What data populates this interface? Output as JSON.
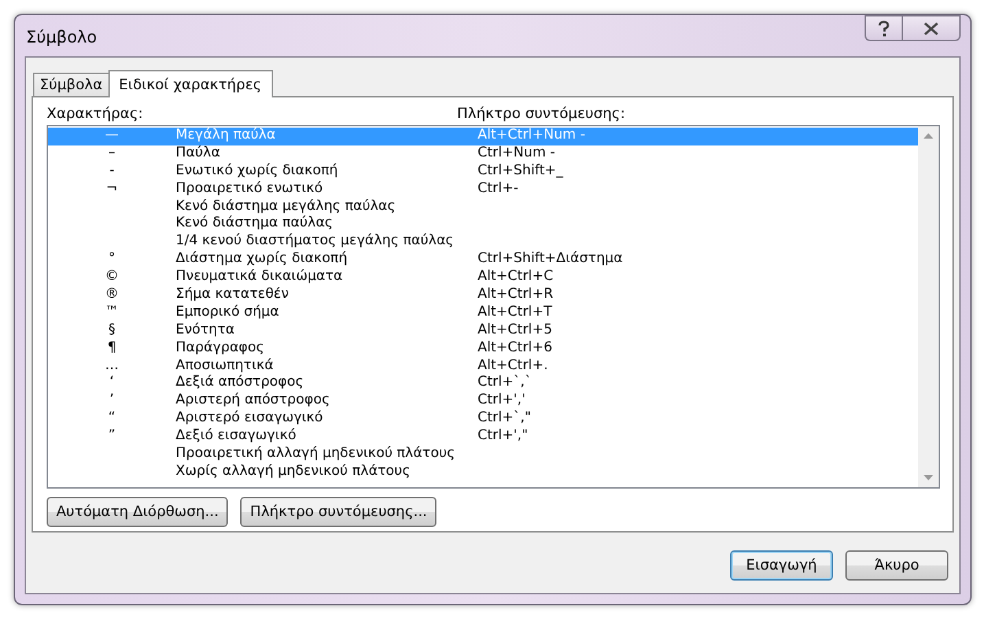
{
  "window": {
    "title": "Σύμβολο"
  },
  "tabs": [
    {
      "label": "Σύμβολα",
      "selected": false
    },
    {
      "label": "Ειδικοί χαρακτήρες",
      "selected": true
    }
  ],
  "list": {
    "columns": [
      "Χαρακτήρας:",
      "Πλήκτρο συντόμευσης:"
    ],
    "rows": [
      {
        "char": "—",
        "name": "Μεγάλη παύλα",
        "shortcut": "Alt+Ctrl+Num -",
        "selected": true
      },
      {
        "char": "–",
        "name": "Παύλα",
        "shortcut": "Ctrl+Num -",
        "selected": false
      },
      {
        "char": "-",
        "name": "Ενωτικό χωρίς διακοπή",
        "shortcut": "Ctrl+Shift+_",
        "selected": false
      },
      {
        "char": "¬",
        "name": "Προαιρετικό ενωτικό",
        "shortcut": "Ctrl+-",
        "selected": false
      },
      {
        "name": "Κενό διάστημα μεγάλης παύλας",
        "selected": false
      },
      {
        "name": "Κενό διάστημα παύλας",
        "selected": false
      },
      {
        "name": "1/4 κενού διαστήματος μεγάλης παύλας",
        "selected": false
      },
      {
        "char": "°",
        "name": "Διάστημα χωρίς διακοπή",
        "shortcut": "Ctrl+Shift+Διάστημα",
        "selected": false
      },
      {
        "char": "©",
        "name": "Πνευματικά δικαιώματα",
        "shortcut": "Alt+Ctrl+C",
        "selected": false
      },
      {
        "char": "®",
        "name": "Σήμα κατατεθέν",
        "shortcut": "Alt+Ctrl+R",
        "selected": false
      },
      {
        "char": "™",
        "name": "Εμπορικό σήμα",
        "shortcut": "Alt+Ctrl+T",
        "selected": false
      },
      {
        "char": "§",
        "name": "Ενότητα",
        "shortcut": "Alt+Ctrl+5",
        "selected": false
      },
      {
        "char": "¶",
        "name": "Παράγραφος",
        "shortcut": "Alt+Ctrl+6",
        "selected": false
      },
      {
        "char": "…",
        "name": "Αποσιωπητικά",
        "shortcut": "Alt+Ctrl+.",
        "selected": false
      },
      {
        "char": "‘",
        "name": "Δεξιά απόστροφος",
        "shortcut": "Ctrl+`,`",
        "selected": false
      },
      {
        "char": "’",
        "name": "Αριστερή απόστροφος",
        "shortcut": "Ctrl+','",
        "selected": false
      },
      {
        "char": "“",
        "name": "Αριστερό εισαγωγικό",
        "shortcut": "Ctrl+`,\"",
        "selected": false
      },
      {
        "char": "”",
        "name": "Δεξιό εισαγωγικό",
        "shortcut": "Ctrl+',\"",
        "selected": false
      },
      {
        "name": "Προαιρετική αλλαγή μηδενικού πλάτους",
        "selected": false
      },
      {
        "name": "Χωρίς αλλαγή μηδενικού πλάτους",
        "selected": false
      }
    ]
  },
  "panel_buttons": [
    "Αυτόματη Διόρθωση...",
    "Πλήκτρο συντόμευσης..."
  ],
  "dialog_buttons": [
    {
      "label": "Εισαγωγή",
      "default": true
    },
    {
      "label": "Άκυρο",
      "default": false
    }
  ]
}
